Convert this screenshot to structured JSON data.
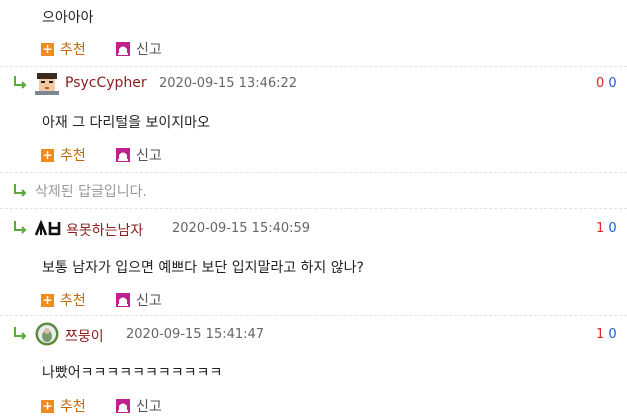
{
  "actions": {
    "recommend_label": "추천",
    "report_label": "신고"
  },
  "comments": [
    {
      "body": "으아아아"
    },
    {
      "nickname": "PsycCypher",
      "date": "2020-09-15 13:46:22",
      "up": "0",
      "down": "0",
      "body": "아재 그 다리털을 보이지마오"
    },
    {
      "deleted_text": "삭제된 답글입니다."
    },
    {
      "nickname": "욕못하는남자",
      "date": "2020-09-15 15:40:59",
      "up": "1",
      "down": "0",
      "body": "보통 남자가 입으면 예쁘다 보단 입지말라고 하지 않나?"
    },
    {
      "nickname": "쯔뭉이",
      "date": "2020-09-15 15:41:47",
      "up": "1",
      "down": "0",
      "body": "나빴어ㅋㅋㅋㅋㅋㅋㅋㅋㅋㅋㅋ"
    }
  ],
  "colors": {
    "recommend": "#f08c1e",
    "report": "#c0208c",
    "reply_arrow": "#5aaa3c",
    "upvote": "#e02424",
    "downvote": "#2458c8",
    "nickname": "#8b1c1c"
  },
  "icons": [
    "plus-icon",
    "report-icon",
    "reply-arrow-icon",
    "avatar"
  ]
}
